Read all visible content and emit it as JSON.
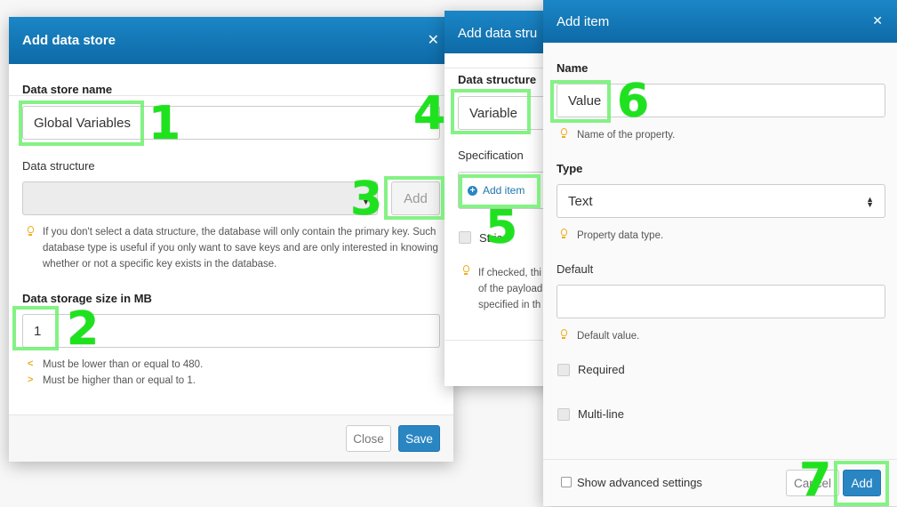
{
  "store_dialog": {
    "title": "Add data store",
    "close_icon": "✕",
    "name_label": "Data store name",
    "name_value": "Global Variables",
    "structure_label": "Data structure",
    "structure_value": "",
    "structure_add_button": "Add",
    "structure_hint": "If you don't select a data structure, the database will only contain the primary key. Such database type is useful if you only want to save keys and are only interested in knowing whether or not a specific key exists in the database.",
    "size_label": "Data storage size in MB",
    "size_value": "1",
    "size_hint_max": "Must be lower than or equal to 480.",
    "size_hint_min": "Must be higher than or equal to 1.",
    "close_button": "Close",
    "save_button": "Save"
  },
  "structure_dialog": {
    "title": "Add data stru",
    "name_label": "Data structure",
    "name_value": "Variable",
    "spec_label": "Specification",
    "add_item_button": "Add item",
    "strict_label": "Stric",
    "strict_hint_lines": [
      "If checked, thi",
      "of the payload",
      "specified in th"
    ]
  },
  "item_dialog": {
    "title": "Add item",
    "close_icon": "✕",
    "name_label": "Name",
    "name_value": "Value",
    "name_hint": "Name of the property.",
    "type_label": "Type",
    "type_value": "Text",
    "type_hint": "Property data type.",
    "default_label": "Default",
    "default_value": "",
    "default_hint": "Default value.",
    "required_label": "Required",
    "multiline_label": "Multi-line",
    "advanced_label": "Show advanced settings",
    "cancel_button": "Cancel",
    "add_button": "Add"
  },
  "annotations": [
    "1",
    "2",
    "3",
    "4",
    "5",
    "6",
    "7"
  ],
  "colors": {
    "header": "#1b86c6",
    "primary_button": "#2a86c3",
    "highlight": "#6ef06e",
    "annotation_number": "#1fe21f",
    "hint_icon": "#f0ad1e"
  }
}
